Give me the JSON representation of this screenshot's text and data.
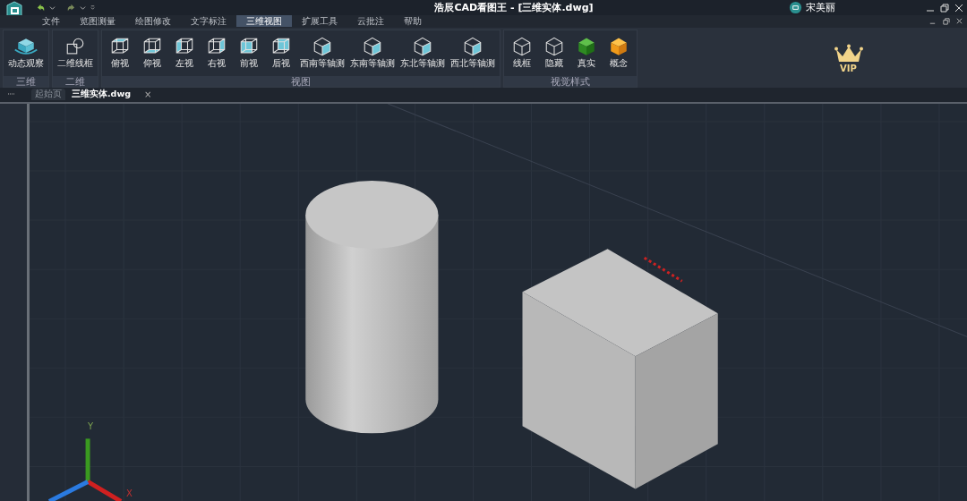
{
  "window": {
    "title": "浩辰CAD看图王 - [三维实体.dwg]",
    "user": "宋美丽"
  },
  "menu": [
    {
      "label": "文件",
      "selected": false
    },
    {
      "label": "览图测量",
      "selected": false
    },
    {
      "label": "绘图修改",
      "selected": false
    },
    {
      "label": "文字标注",
      "selected": false
    },
    {
      "label": "三维视图",
      "selected": true
    },
    {
      "label": "扩展工具",
      "selected": false
    },
    {
      "label": "云批注",
      "selected": false
    },
    {
      "label": "帮助",
      "selected": false
    }
  ],
  "ribbon": [
    {
      "label": "三维",
      "buttons": [
        {
          "label": "动态观察",
          "kind": "orbit"
        }
      ]
    },
    {
      "label": "二维",
      "buttons": [
        {
          "label": "二维线框",
          "kind": "wire2d"
        }
      ]
    },
    {
      "label": "视图",
      "buttons": [
        {
          "label": "俯视",
          "kind": "top"
        },
        {
          "label": "仰视",
          "kind": "bottom"
        },
        {
          "label": "左视",
          "kind": "left"
        },
        {
          "label": "右视",
          "kind": "right"
        },
        {
          "label": "前视",
          "kind": "front"
        },
        {
          "label": "后视",
          "kind": "back"
        },
        {
          "label": "西南等轴测",
          "kind": "iso"
        },
        {
          "label": "东南等轴测",
          "kind": "iso"
        },
        {
          "label": "东北等轴测",
          "kind": "iso"
        },
        {
          "label": "西北等轴测",
          "kind": "iso"
        }
      ]
    },
    {
      "label": "视觉样式",
      "buttons": [
        {
          "label": "线框",
          "kind": "wire"
        },
        {
          "label": "隐藏",
          "kind": "hidden"
        },
        {
          "label": "真实",
          "kind": "real"
        },
        {
          "label": "概念",
          "kind": "concept"
        }
      ]
    }
  ],
  "vip": {
    "label": "VIP"
  },
  "doc_tabs": [
    {
      "label": "起始页",
      "selected": false,
      "closable": false
    },
    {
      "label": "三维实体.dwg",
      "selected": true,
      "closable": true
    }
  ],
  "close_glyph": "×",
  "axes": {
    "x": "X",
    "y": "Y"
  }
}
